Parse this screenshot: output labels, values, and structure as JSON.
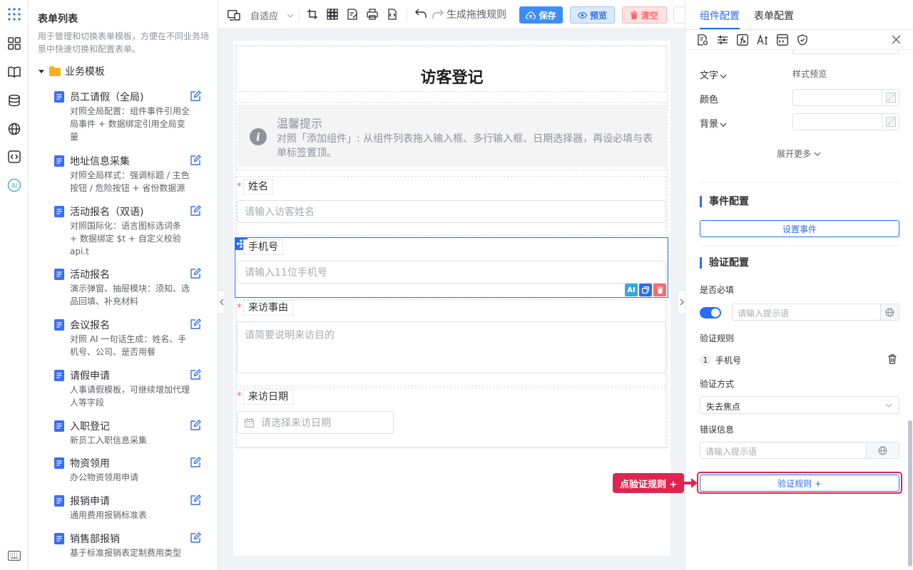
{
  "left_panel": {
    "title": "表单列表",
    "description": "用于管理和切换表单模板，方便在不同业务场景中快速切换和配置表单。",
    "folder_label": "业务模板",
    "templates": [
      {
        "name": "员工请假（全局)",
        "desc": "对照全局配置：组件事件引用全局事件 + 数据绑定引用全局变量"
      },
      {
        "name": "地址信息采集",
        "desc": "对照全局样式：强调标题 / 主色按钮 / 危险按钮 + 省份数据源"
      },
      {
        "name": "活动报名（双语)",
        "desc": "对照国际化：语言图标选词条 + 数据绑定 $t + 自定义校验 api.t"
      },
      {
        "name": "活动报名",
        "desc": "演示弹窗、抽屉模块：须知、选品回填、补充材料"
      },
      {
        "name": "会议报名",
        "desc": "对照 AI 一句话生成：姓名、手机号、公司、是否用餐"
      },
      {
        "name": "请假申请",
        "desc": "人事请假模板，可继续增加代理人等字段"
      },
      {
        "name": "入职登记",
        "desc": "新员工入职信息采集"
      },
      {
        "name": "物资领用",
        "desc": "办公物资领用申请"
      },
      {
        "name": "报销申请",
        "desc": "通用费用报销标准表"
      },
      {
        "name": "销售部报销",
        "desc": "基于标准报销表定制费用类型"
      }
    ]
  },
  "toolbar": {
    "adaptive_label": "自适应",
    "generate_label": "生成拖拽规则",
    "save_label": "保存",
    "preview_label": "预览",
    "clear_label": "清空"
  },
  "form": {
    "title": "访客登记",
    "tip_title": "温馨提示",
    "tip_text": "对照「添加组件」: 从组件列表拖入输入框、多行输入框、日期选择器，再设必填与表单标签置顶。",
    "fields": {
      "name_label": "姓名",
      "name_placeholder": "请输入访客姓名",
      "phone_label": "手机号",
      "phone_placeholder": "请输入11位手机号",
      "reason_label": "来访事由",
      "reason_placeholder": "请简要说明来访目的",
      "date_label": "来访日期",
      "date_placeholder": "请选择来访日期"
    },
    "required_mark": "*",
    "ai_badge": "AI"
  },
  "right_panel": {
    "tabs": [
      "组件配置",
      "表单配置"
    ],
    "text_label": "文字",
    "style_preview": "样式预览",
    "color_label": "颜色",
    "background_label": "背景",
    "expand_more": "展开更多",
    "event_section": "事件配置",
    "set_event": "设置事件",
    "validation_section": "验证配置",
    "required_label": "是否必填",
    "hint_placeholder": "请输入提示语",
    "rules_label": "验证规则",
    "rule_index": "1",
    "rule_name": "手机号",
    "method_label": "验证方式",
    "method_value": "失去焦点",
    "error_label": "错误信息",
    "error_placeholder": "请输入提示语",
    "add_rule": "验证规则 +",
    "callout": "点验证规则 +",
    "required_on": true
  },
  "colors": {
    "primary": "#2b6cf6",
    "danger": "#f56c6c",
    "callout": "#e0244f"
  }
}
